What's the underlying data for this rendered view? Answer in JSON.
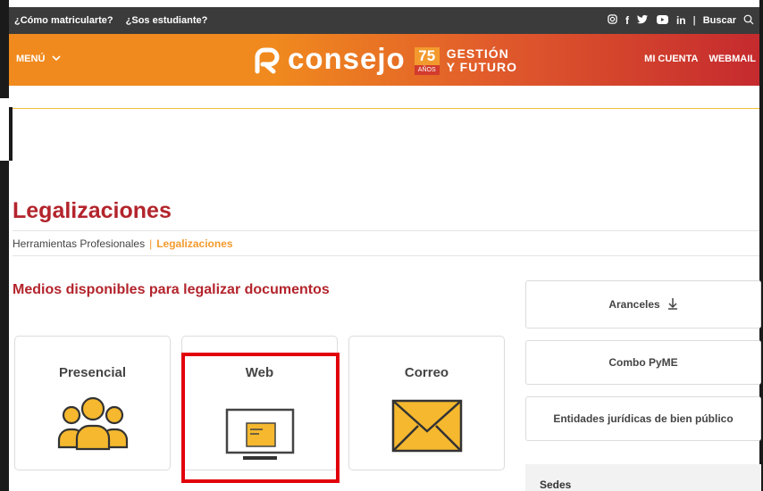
{
  "topbar": {
    "link1": "¿Cómo matricularte?",
    "link2": "¿Sos estudiante?",
    "search_label": "Buscar",
    "social": [
      "instagram-icon",
      "facebook-icon",
      "twitter-icon",
      "youtube-icon",
      "linkedin-icon"
    ]
  },
  "header": {
    "menu_label": "MENÚ",
    "logo_text": "consejo",
    "anniv_number": "75",
    "anniv_label": "AÑOS",
    "slogan_line1": "GESTIÓN",
    "slogan_line2": "Y FUTURO",
    "nav_account": "MI CUENTA",
    "nav_webmail": "WEBMAIL",
    "colors": {
      "orange": "#f08a1e",
      "red": "#c52a2e"
    }
  },
  "page": {
    "title": "Legalizaciones",
    "breadcrumb_parent": "Herramientas Profesionales",
    "breadcrumb_sep": "|",
    "breadcrumb_current": "Legalizaciones",
    "section_title": "Medios disponibles para legalizar documentos"
  },
  "cards": [
    {
      "label": "Presencial",
      "icon": "people-icon"
    },
    {
      "label": "Web",
      "icon": "monitor-icon"
    },
    {
      "label": "Correo",
      "icon": "envelope-icon"
    }
  ],
  "sidebar": {
    "aranceles": "Aranceles",
    "combo": "Combo PyME",
    "entidades": "Entidades jurídicas de bien público",
    "sedes": "Sedes"
  }
}
